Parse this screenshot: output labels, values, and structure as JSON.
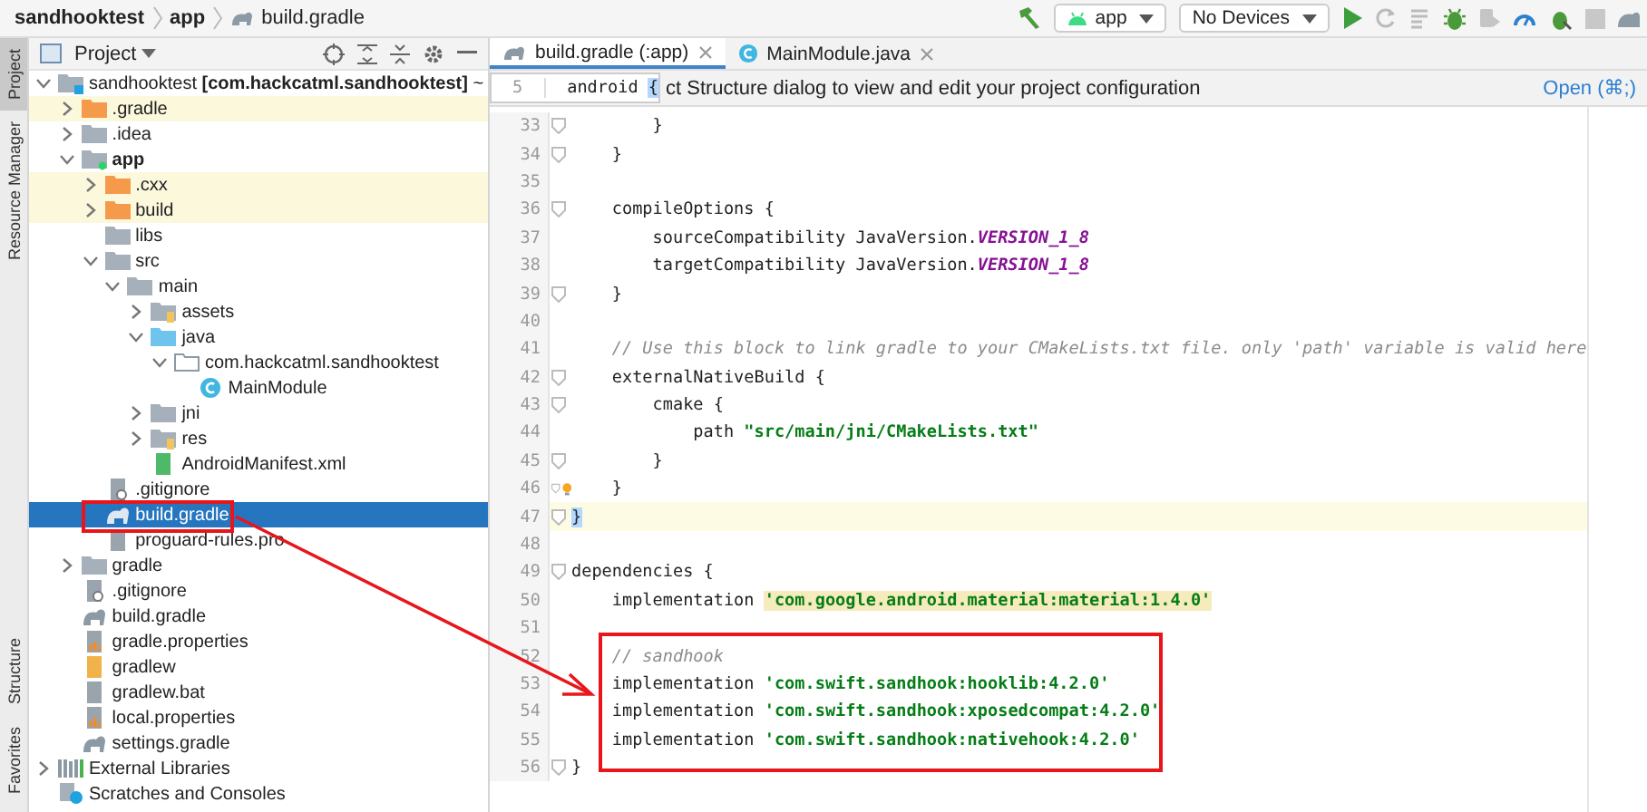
{
  "breadcrumbs": [
    {
      "label": "sandhooktest",
      "kind": "folder"
    },
    {
      "label": "app",
      "kind": "folder"
    },
    {
      "label": "build.gradle",
      "kind": "gradle"
    }
  ],
  "toolbar": {
    "config": "app",
    "device": "No Devices"
  },
  "side_tabs_top": [
    {
      "label": "Project",
      "selected": true
    },
    {
      "label": "Resource Manager",
      "selected": false
    }
  ],
  "side_tabs_bottom": [
    {
      "label": "Structure",
      "selected": false
    },
    {
      "label": "Favorites",
      "selected": false
    }
  ],
  "project_panel": {
    "title": "Project",
    "tree": [
      {
        "label": "sandhooktest **[com.hackcatml.sandhooktest]** ~",
        "kind": "module",
        "expanded": true,
        "selected": false,
        "children": [
          {
            "label": ".gradle",
            "kind": "excluded",
            "expanded": false,
            "selected": false
          },
          {
            "label": ".idea",
            "kind": "folder",
            "expanded": false,
            "selected": false
          },
          {
            "label": "app",
            "kind": "app-module",
            "bold": true,
            "expanded": true,
            "selected": false,
            "children": [
              {
                "label": ".cxx",
                "kind": "excluded",
                "expanded": false,
                "selected": false
              },
              {
                "label": "build",
                "kind": "excluded",
                "expanded": false,
                "selected": false
              },
              {
                "label": "libs",
                "kind": "folder",
                "selected": false
              },
              {
                "label": "src",
                "kind": "folder",
                "expanded": true,
                "selected": false,
                "children": [
                  {
                    "label": "main",
                    "kind": "folder",
                    "expanded": true,
                    "selected": false,
                    "children": [
                      {
                        "label": "assets",
                        "kind": "resource",
                        "expanded": false,
                        "selected": false
                      },
                      {
                        "label": "java",
                        "kind": "source",
                        "expanded": true,
                        "selected": false,
                        "children": [
                          {
                            "label": "com.hackcatml.sandhooktest",
                            "kind": "package",
                            "expanded": true,
                            "selected": false,
                            "children": [
                              {
                                "label": "MainModule",
                                "kind": "class",
                                "selected": false
                              }
                            ]
                          }
                        ]
                      },
                      {
                        "label": "jni",
                        "kind": "folder",
                        "expanded": false,
                        "selected": false
                      },
                      {
                        "label": "res",
                        "kind": "resource",
                        "expanded": false,
                        "selected": false
                      },
                      {
                        "label": "AndroidManifest.xml",
                        "kind": "manifest",
                        "selected": false
                      }
                    ]
                  }
                ]
              },
              {
                "label": ".gitignore",
                "kind": "ignore",
                "selected": false
              },
              {
                "label": "build.gradle",
                "kind": "gradle",
                "selected": true
              },
              {
                "label": "proguard-rules.pro",
                "kind": "file",
                "selected": false
              }
            ]
          },
          {
            "label": "gradle",
            "kind": "folder",
            "expanded": false,
            "selected": false
          },
          {
            "label": ".gitignore",
            "kind": "ignore",
            "selected": false
          },
          {
            "label": "build.gradle",
            "kind": "gradle",
            "selected": false
          },
          {
            "label": "gradle.properties",
            "kind": "properties",
            "selected": false
          },
          {
            "label": "gradlew",
            "kind": "script",
            "selected": false
          },
          {
            "label": "gradlew.bat",
            "kind": "file",
            "selected": false
          },
          {
            "label": "local.properties",
            "kind": "properties",
            "selected": false
          },
          {
            "label": "settings.gradle",
            "kind": "gradle",
            "selected": false
          }
        ]
      },
      {
        "label": "External Libraries",
        "kind": "libraries",
        "expanded": false,
        "selected": false
      },
      {
        "label": "Scratches and Consoles",
        "kind": "scratches",
        "selected": false
      }
    ]
  },
  "editor": {
    "tabs": [
      {
        "label": "build.gradle (:app)",
        "kind": "gradle",
        "selected": true
      },
      {
        "label": "MainModule.java",
        "kind": "class",
        "selected": false
      }
    ],
    "banner": {
      "text": "ct Structure dialog to view and edit your project configuration",
      "link": "Open (⌘;)"
    },
    "sticky_line": {
      "number": "5",
      "code": "android ",
      "brace": "{"
    },
    "lines": [
      {
        "number": "33",
        "fold": true,
        "segments": [
          {
            "kind": "plain",
            "text": "        }"
          }
        ]
      },
      {
        "number": "34",
        "fold": true,
        "segments": [
          {
            "kind": "plain",
            "text": "    }"
          }
        ]
      },
      {
        "number": "35"
      },
      {
        "number": "36",
        "fold": true,
        "segments": [
          {
            "kind": "plain",
            "text": "    compileOptions {"
          }
        ]
      },
      {
        "number": "37",
        "segments": [
          {
            "kind": "plain",
            "text": "        sourceCompatibility JavaVersion."
          },
          {
            "kind": "constant",
            "text": "VERSION_1_8"
          }
        ]
      },
      {
        "number": "38",
        "segments": [
          {
            "kind": "plain",
            "text": "        targetCompatibility JavaVersion."
          },
          {
            "kind": "constant",
            "text": "VERSION_1_8"
          }
        ]
      },
      {
        "number": "39",
        "fold": true,
        "segments": [
          {
            "kind": "plain",
            "text": "    }"
          }
        ]
      },
      {
        "number": "40"
      },
      {
        "number": "41",
        "segments": [
          {
            "kind": "comment",
            "text": "    // Use this block to link gradle to your CMakeLists.txt file. only 'path' variable is valid here"
          }
        ]
      },
      {
        "number": "42",
        "fold": true,
        "segments": [
          {
            "kind": "plain",
            "text": "    externalNativeBuild {"
          }
        ]
      },
      {
        "number": "43",
        "fold": true,
        "segments": [
          {
            "kind": "plain",
            "text": "        cmake {"
          }
        ]
      },
      {
        "number": "44",
        "segments": [
          {
            "kind": "plain",
            "text": "            path "
          },
          {
            "kind": "string",
            "text": "\"src/main/jni/CMakeLists.txt\""
          }
        ]
      },
      {
        "number": "45",
        "fold": true,
        "segments": [
          {
            "kind": "plain",
            "text": "        }"
          }
        ]
      },
      {
        "number": "46",
        "fold": true,
        "bulb": true,
        "segments": [
          {
            "kind": "plain",
            "text": "    }"
          }
        ]
      },
      {
        "number": "47",
        "fold": true,
        "current": true,
        "segments": [
          {
            "kind": "brace",
            "text": "}"
          }
        ]
      },
      {
        "number": "48"
      },
      {
        "number": "49",
        "fold": true,
        "segments": [
          {
            "kind": "plain",
            "text": "dependencies {"
          }
        ]
      },
      {
        "number": "50",
        "segments": [
          {
            "kind": "plain",
            "text": "    implementation "
          },
          {
            "kind": "string-marked",
            "text": "'com.google.android.material:material:1.4.0'"
          }
        ]
      },
      {
        "number": "51"
      },
      {
        "number": "52",
        "segments": [
          {
            "kind": "comment",
            "text": "    // sandhook"
          }
        ]
      },
      {
        "number": "53",
        "segments": [
          {
            "kind": "plain",
            "text": "    implementation "
          },
          {
            "kind": "string",
            "text": "'com.swift.sandhook:hooklib:4.2.0'"
          }
        ]
      },
      {
        "number": "54",
        "segments": [
          {
            "kind": "plain",
            "text": "    implementation "
          },
          {
            "kind": "string",
            "text": "'com.swift.sandhook:xposedcompat:4.2.0'"
          }
        ]
      },
      {
        "number": "55",
        "segments": [
          {
            "kind": "plain",
            "text": "    implementation "
          },
          {
            "kind": "string",
            "text": "'com.swift.sandhook:nativehook:4.2.0'"
          }
        ]
      },
      {
        "number": "56",
        "fold": true,
        "segments": [
          {
            "kind": "plain",
            "text": "}"
          }
        ]
      }
    ]
  }
}
